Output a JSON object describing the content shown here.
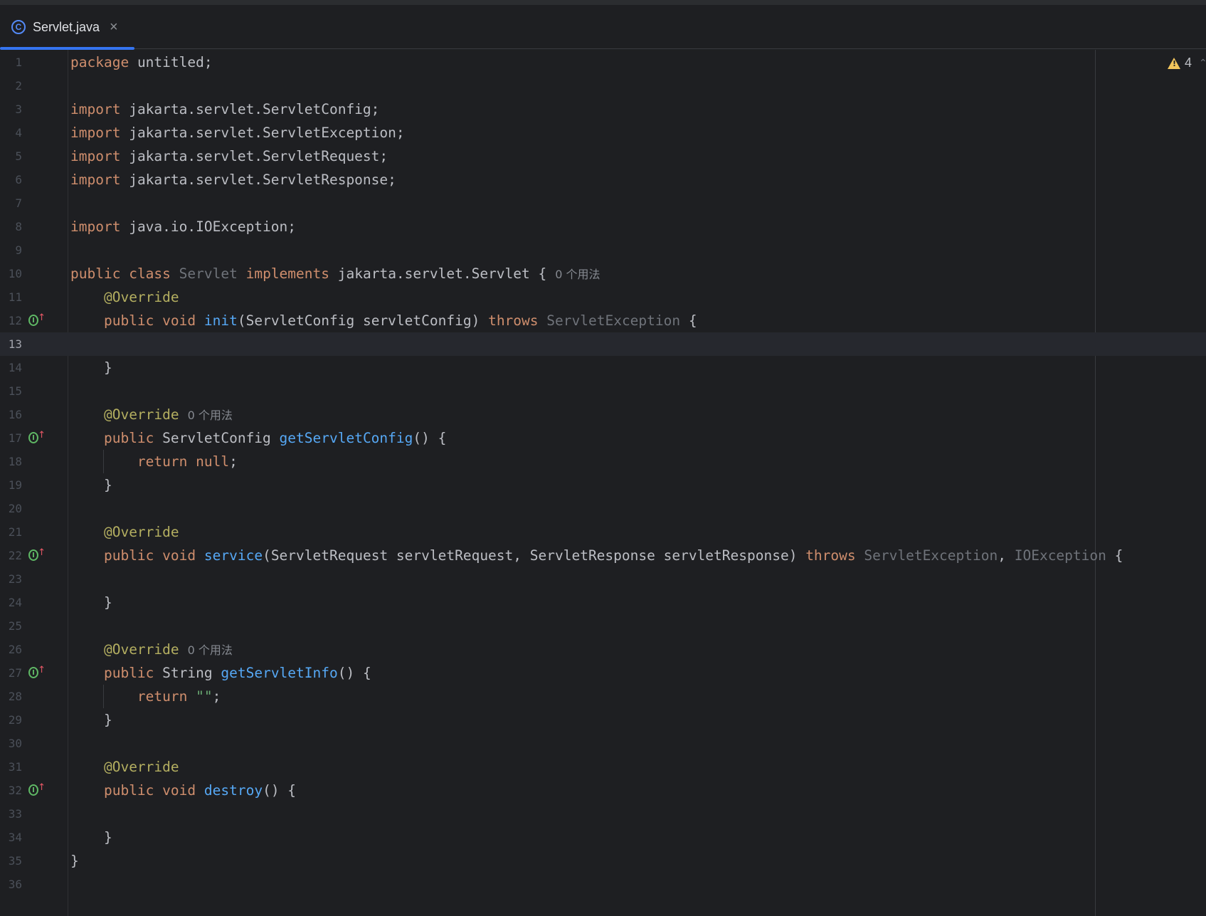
{
  "tab": {
    "icon_letter": "C",
    "title": "Servlet.java",
    "close": "×"
  },
  "inspections": {
    "warning_count": "4"
  },
  "lines": [
    {
      "n": "1",
      "tokens": [
        [
          "kw",
          "package"
        ],
        [
          "",
          "untitled;"
        ]
      ]
    },
    {
      "n": "2",
      "tokens": []
    },
    {
      "n": "3",
      "tokens": [
        [
          "kw",
          "import"
        ],
        [
          "",
          "jakarta.servlet.ServletConfig;"
        ]
      ]
    },
    {
      "n": "4",
      "tokens": [
        [
          "kw",
          "import"
        ],
        [
          "",
          "jakarta.servlet.ServletException;"
        ]
      ]
    },
    {
      "n": "5",
      "tokens": [
        [
          "kw",
          "import"
        ],
        [
          "",
          "jakarta.servlet.ServletRequest;"
        ]
      ]
    },
    {
      "n": "6",
      "tokens": [
        [
          "kw",
          "import"
        ],
        [
          "",
          "jakarta.servlet.ServletResponse;"
        ]
      ]
    },
    {
      "n": "7",
      "tokens": []
    },
    {
      "n": "8",
      "tokens": [
        [
          "kw",
          "import"
        ],
        [
          "",
          "java.io.IOException;"
        ]
      ]
    },
    {
      "n": "9",
      "tokens": []
    },
    {
      "n": "10",
      "tokens": [
        [
          "kw",
          "public"
        ],
        [
          "kw",
          "class"
        ],
        [
          "unused",
          "Servlet"
        ],
        [
          "kw",
          "implements"
        ],
        [
          "",
          "jakarta.servlet.Servlet {"
        ]
      ],
      "hint": "0 个用法"
    },
    {
      "n": "11",
      "indent": 1,
      "tokens": [
        [
          "ann",
          "@Override"
        ]
      ]
    },
    {
      "n": "12",
      "indent": 1,
      "gutter": true,
      "tokens": [
        [
          "kw",
          "public"
        ],
        [
          "kw",
          "void"
        ],
        [
          "fn",
          "init"
        ],
        [
          "",
          "(ServletConfig servletConfig)"
        ],
        [
          "kw",
          "throws"
        ],
        [
          "unused",
          "ServletException"
        ],
        [
          "",
          "{"
        ]
      ]
    },
    {
      "n": "13",
      "current": true,
      "tokens": []
    },
    {
      "n": "14",
      "indent": 1,
      "tokens": [
        [
          "",
          "}"
        ]
      ]
    },
    {
      "n": "15",
      "tokens": []
    },
    {
      "n": "16",
      "indent": 1,
      "tokens": [
        [
          "ann",
          "@Override"
        ]
      ],
      "hint": "0 个用法"
    },
    {
      "n": "17",
      "indent": 1,
      "gutter": true,
      "tokens": [
        [
          "kw",
          "public"
        ],
        [
          "",
          "ServletConfig"
        ],
        [
          "fn",
          "getServletConfig"
        ],
        [
          "",
          "() {"
        ]
      ]
    },
    {
      "n": "18",
      "indent": 2,
      "tokens": [
        [
          "kw",
          "return"
        ],
        [
          "kw",
          "null"
        ],
        [
          "",
          ";"
        ]
      ]
    },
    {
      "n": "19",
      "indent": 1,
      "tokens": [
        [
          "",
          "}"
        ]
      ]
    },
    {
      "n": "20",
      "tokens": []
    },
    {
      "n": "21",
      "indent": 1,
      "tokens": [
        [
          "ann",
          "@Override"
        ]
      ]
    },
    {
      "n": "22",
      "indent": 1,
      "gutter": true,
      "tokens": [
        [
          "kw",
          "public"
        ],
        [
          "kw",
          "void"
        ],
        [
          "fn",
          "service"
        ],
        [
          "",
          "(ServletRequest servletRequest, ServletResponse servletResponse)"
        ],
        [
          "kw",
          "throws"
        ],
        [
          "unused",
          "ServletException"
        ],
        [
          "",
          ","
        ],
        [
          "unused",
          "IOException"
        ],
        [
          "",
          "{"
        ]
      ]
    },
    {
      "n": "23",
      "tokens": []
    },
    {
      "n": "24",
      "indent": 1,
      "tokens": [
        [
          "",
          "}"
        ]
      ]
    },
    {
      "n": "25",
      "tokens": []
    },
    {
      "n": "26",
      "indent": 1,
      "tokens": [
        [
          "ann",
          "@Override"
        ]
      ],
      "hint": "0 个用法"
    },
    {
      "n": "27",
      "indent": 1,
      "gutter": true,
      "tokens": [
        [
          "kw",
          "public"
        ],
        [
          "",
          "String"
        ],
        [
          "fn",
          "getServletInfo"
        ],
        [
          "",
          "() {"
        ]
      ]
    },
    {
      "n": "28",
      "indent": 2,
      "tokens": [
        [
          "kw",
          "return"
        ],
        [
          "str",
          "\"\""
        ],
        [
          "",
          ";"
        ]
      ]
    },
    {
      "n": "29",
      "indent": 1,
      "tokens": [
        [
          "",
          "}"
        ]
      ]
    },
    {
      "n": "30",
      "tokens": []
    },
    {
      "n": "31",
      "indent": 1,
      "tokens": [
        [
          "ann",
          "@Override"
        ]
      ]
    },
    {
      "n": "32",
      "indent": 1,
      "gutter": true,
      "tokens": [
        [
          "kw",
          "public"
        ],
        [
          "kw",
          "void"
        ],
        [
          "fn",
          "destroy"
        ],
        [
          "",
          "() {"
        ]
      ]
    },
    {
      "n": "33",
      "tokens": []
    },
    {
      "n": "34",
      "indent": 1,
      "tokens": [
        [
          "",
          "}"
        ]
      ]
    },
    {
      "n": "35",
      "tokens": [
        [
          "",
          "}"
        ]
      ]
    },
    {
      "n": "36",
      "tokens": []
    }
  ],
  "gutter_icon": {
    "letter": "I",
    "arrow": "↑"
  },
  "colors": {
    "keyword": "#cf8e6d",
    "annotation": "#b3ae60",
    "function": "#56a8f5",
    "string": "#6aab73",
    "text": "#bcbec4",
    "background": "#1e1f22"
  }
}
